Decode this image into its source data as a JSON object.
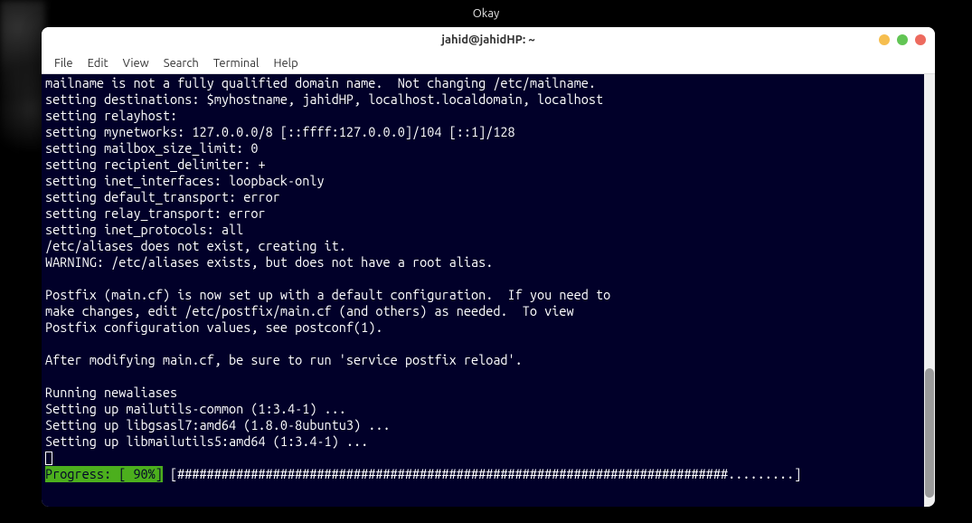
{
  "desktop": {
    "okay_label": "Okay"
  },
  "window": {
    "title": "jahid@jahidHP: ~",
    "menu": {
      "file": "File",
      "edit": "Edit",
      "view": "View",
      "search": "Search",
      "terminal": "Terminal",
      "help": "Help"
    }
  },
  "terminal": {
    "lines": [
      "mailname is not a fully qualified domain name.  Not changing /etc/mailname.",
      "setting destinations: $myhostname, jahidHP, localhost.localdomain, localhost",
      "setting relayhost:",
      "setting mynetworks: 127.0.0.0/8 [::ffff:127.0.0.0]/104 [::1]/128",
      "setting mailbox_size_limit: 0",
      "setting recipient_delimiter: +",
      "setting inet_interfaces: loopback-only",
      "setting default_transport: error",
      "setting relay_transport: error",
      "setting inet_protocols: all",
      "/etc/aliases does not exist, creating it.",
      "WARNING: /etc/aliases exists, but does not have a root alias.",
      "",
      "Postfix (main.cf) is now set up with a default configuration.  If you need to",
      "make changes, edit /etc/postfix/main.cf (and others) as needed.  To view",
      "Postfix configuration values, see postconf(1).",
      "",
      "After modifying main.cf, be sure to run 'service postfix reload'.",
      "",
      "Running newaliases",
      "Setting up mailutils-common (1:3.4-1) ...",
      "Setting up libgsasl7:amd64 (1.8.0-8ubuntu3) ...",
      "Setting up libmailutils5:amd64 (1:3.4-1) ..."
    ],
    "progress": {
      "label": "Progress: [ 90%]",
      "bar": " [###########################################################################.........] "
    }
  }
}
